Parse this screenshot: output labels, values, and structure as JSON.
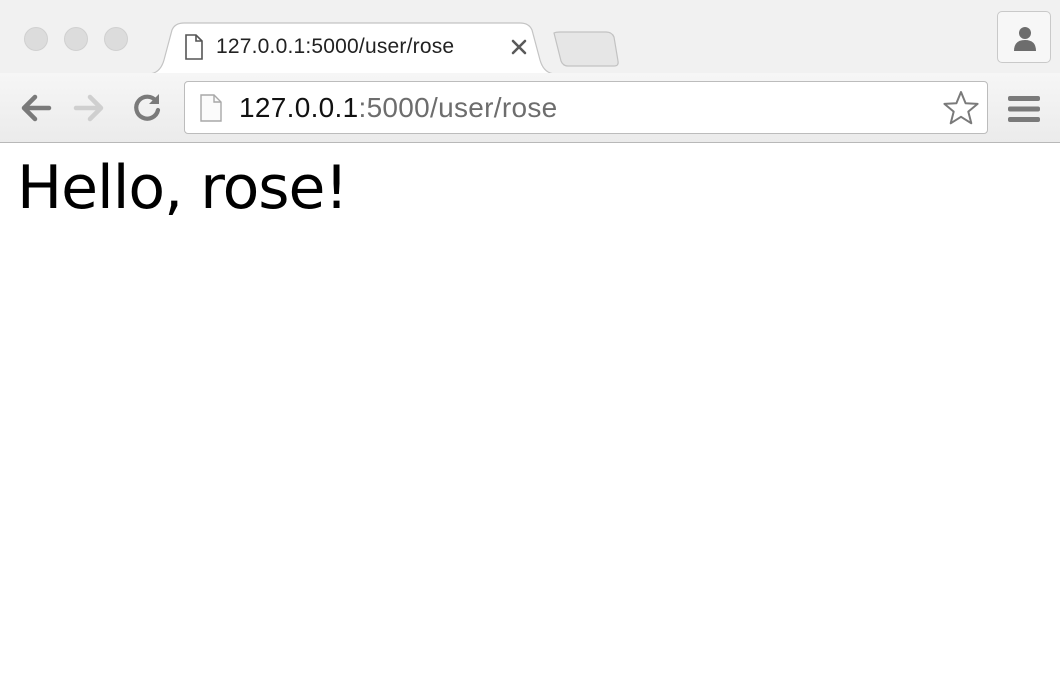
{
  "window": {
    "traffic_lights": [
      "close",
      "minimize",
      "zoom"
    ]
  },
  "tab": {
    "title": "127.0.0.1:5000/user/rose",
    "icon": "page-icon",
    "close_icon": "close-icon"
  },
  "toolbar": {
    "back_icon": "back-arrow-icon",
    "forward_icon": "forward-arrow-icon",
    "reload_icon": "reload-icon",
    "menu_icon": "hamburger-menu-icon",
    "profile_icon": "profile-icon"
  },
  "omnibox": {
    "host": "127.0.0.1",
    "path": ":5000/user/rose",
    "star_icon": "bookmark-star-icon"
  },
  "page": {
    "heading": "Hello, rose!"
  },
  "colors": {
    "chrome_bg": "#f1f1f1",
    "toolbar_bg": "#ebebeb",
    "url_host": "#111111",
    "url_path": "#6d6d6d",
    "text": "#000000"
  }
}
